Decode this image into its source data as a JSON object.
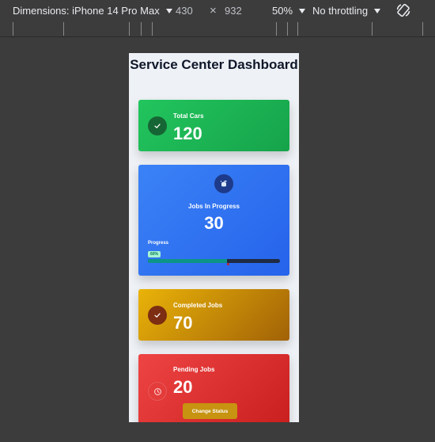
{
  "toolbar": {
    "dimensions_label": "Dimensions: iPhone 14 Pro Max",
    "width": "430",
    "height": "932",
    "times": "×",
    "zoom": "50%",
    "throttling": "No throttling",
    "rotate_icon": "rotate-icon"
  },
  "page": {
    "title": "Service Center Dashboard"
  },
  "cards": {
    "total": {
      "label": "Total Cars",
      "value": "120",
      "icon": "check-icon",
      "color": "#22c55e"
    },
    "in_progress": {
      "label": "Jobs In Progress",
      "value": "30",
      "icon": "spray-icon",
      "color": "#3b82f6",
      "progress_label": "Progress",
      "progress_badge": "60%",
      "progress_fraction": 0.6
    },
    "completed": {
      "label": "Completed Jobs",
      "value": "70",
      "icon": "check-icon",
      "color": "#eab308"
    },
    "pending": {
      "label": "Pending Jobs",
      "value": "20",
      "icon": "clock-icon",
      "color": "#ef4444",
      "button_label": "Change Status"
    }
  }
}
